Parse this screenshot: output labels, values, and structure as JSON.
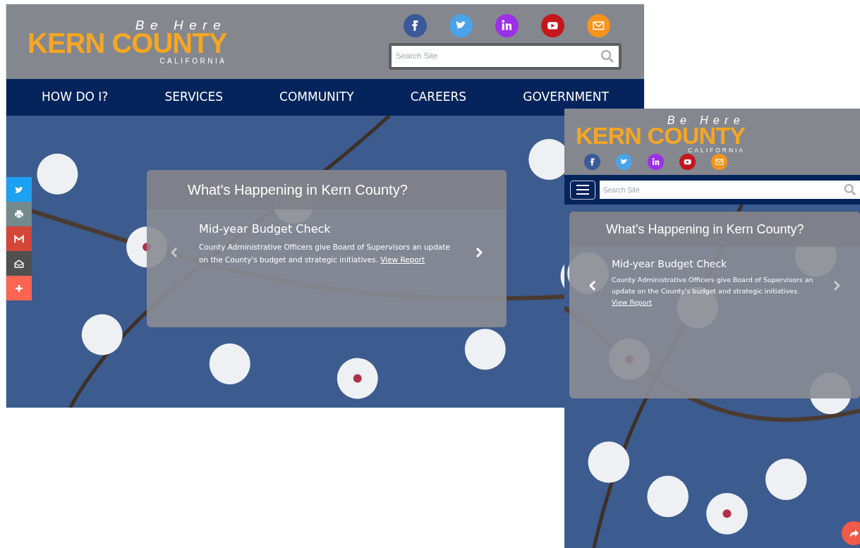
{
  "desktop_view": {
    "logo": {
      "tagline": "Be Here",
      "name": "KERN COUNTY",
      "state": "CALIFORNIA"
    },
    "social_links": [
      {
        "kind": "facebook",
        "color": "#3b5998"
      },
      {
        "kind": "twitter",
        "color": "#4aa3e8"
      },
      {
        "kind": "linkedin",
        "color": "#9b30e8"
      },
      {
        "kind": "youtube",
        "color": "#c4161c"
      },
      {
        "kind": "email",
        "color": "#f7941d"
      }
    ],
    "search": {
      "placeholder": "Search Site"
    },
    "nav_items": [
      "HOW DO I?",
      "SERVICES",
      "COMMUNITY",
      "CAREERS",
      "GOVERNMENT"
    ],
    "share_bar": [
      {
        "kind": "twitter",
        "color": "#1da1f2"
      },
      {
        "kind": "print",
        "color": "#738a8d"
      },
      {
        "kind": "gmail",
        "color": "#d44638"
      },
      {
        "kind": "mail",
        "color": "#505050"
      },
      {
        "kind": "more",
        "color": "#ff6550"
      }
    ],
    "carousel": {
      "heading": "What's Happening in Kern County?",
      "slide_title": "Mid-year Budget Check",
      "slide_text": "County Administrative Officers give Board of Supervisors an update on the County's budget and strategic initiatives.",
      "link": "View Report"
    }
  },
  "mobile_view": {
    "logo": {
      "tagline": "Be Here",
      "name": "KERN COUNTY",
      "state": "CALIFORNIA"
    },
    "social_links": [
      {
        "kind": "facebook",
        "color": "#3b5998"
      },
      {
        "kind": "twitter",
        "color": "#4aa3e8"
      },
      {
        "kind": "linkedin",
        "color": "#9b30e8"
      },
      {
        "kind": "youtube",
        "color": "#c4161c"
      },
      {
        "kind": "email",
        "color": "#f7941d"
      }
    ],
    "search": {
      "placeholder": "Search Site"
    },
    "carousel": {
      "heading": "What's Happening in Kern County?",
      "slide_title": "Mid-year Budget Check",
      "slide_text": "County Administrative Officers give Board of Supervisors an update on the County's budget and strategic initiatives.",
      "link": "View Report"
    },
    "share_button": {
      "kind": "share"
    }
  }
}
